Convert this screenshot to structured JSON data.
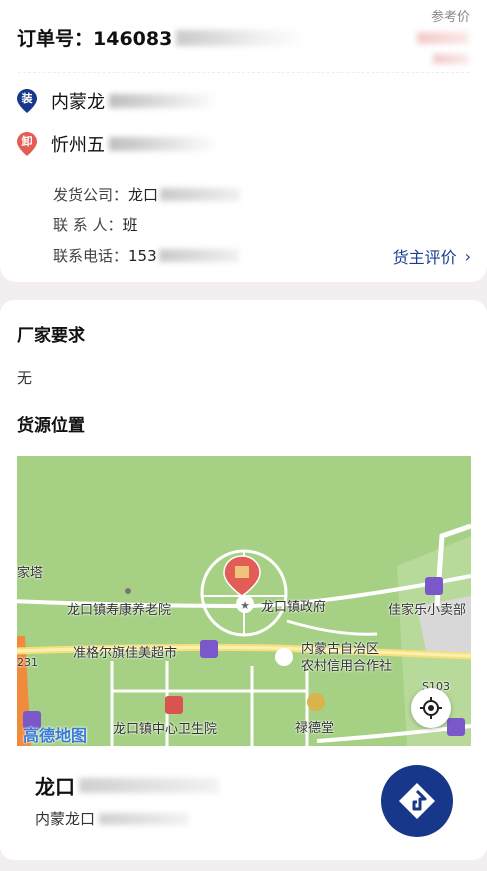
{
  "order": {
    "label": "订单号：146083",
    "ref_price_label": "参考价"
  },
  "route": {
    "load_badge": "装",
    "load_text": "内蒙龙",
    "unload_badge": "卸",
    "unload_text": "忻州五"
  },
  "shipper": {
    "company_label": "发货公司：",
    "company_value": "龙口",
    "contact_label": "联 系 人：",
    "contact_value": "班",
    "phone_label": "联系电话：",
    "phone_value": "153",
    "rate_link": "货主评价"
  },
  "requirements": {
    "title": "厂家要求",
    "value": "无"
  },
  "location": {
    "title": "货源位置"
  },
  "map": {
    "labels": {
      "l1": "家塔",
      "l2": "龙口镇寿康养老院",
      "l3": "龙口镇政府",
      "l4": "佳家乐小卖部",
      "l5": "准格尔旗佳美超市",
      "l6": "内蒙古自治区",
      "l7": "农村信用合作社",
      "l8": "龙口镇中心卫生院",
      "l9": "禄德堂",
      "l10": "S103",
      "l11": "231",
      "l12": "高德地图"
    }
  },
  "destination": {
    "name": "龙口",
    "address": "内蒙龙口"
  },
  "colors": {
    "accent": "#17378a",
    "link": "#1a3d8f",
    "map_green": "#a6d185",
    "pin_red": "#e25d55"
  }
}
